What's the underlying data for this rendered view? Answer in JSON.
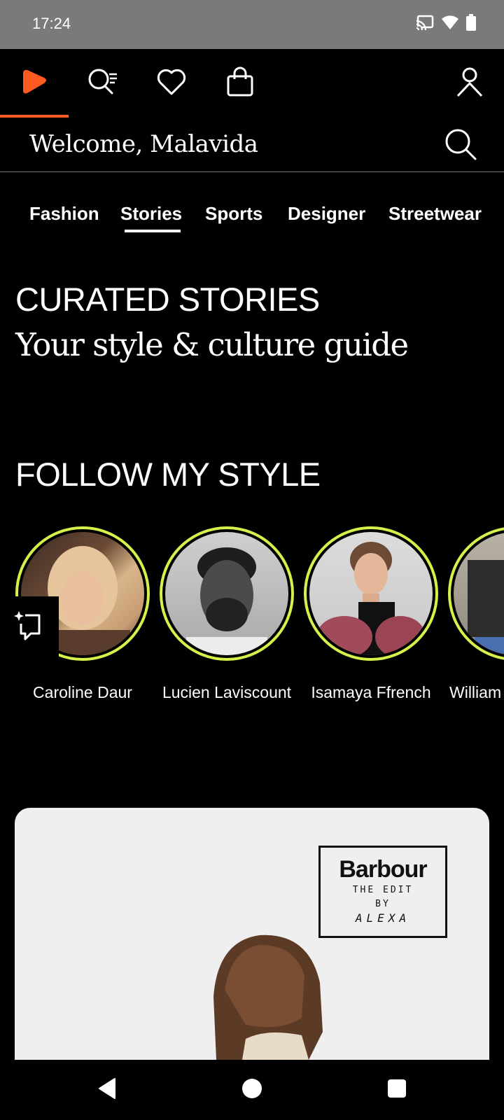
{
  "status_bar": {
    "time": "17:24",
    "icons": [
      "cast-icon",
      "wifi-icon",
      "battery-icon"
    ]
  },
  "top_nav": {
    "items": [
      "home-icon",
      "search-list-icon",
      "heart-icon",
      "bag-icon",
      "profile-icon"
    ],
    "active": "home-icon",
    "accent_color": "#ff5a1f"
  },
  "header": {
    "welcome": "Welcome, Malavida"
  },
  "tabs": {
    "items": [
      "Fashion",
      "Stories",
      "Sports",
      "Designer",
      "Streetwear"
    ],
    "selected": "Stories"
  },
  "curated": {
    "title": "CURATED STORIES",
    "subtitle": "Your style & culture guide"
  },
  "follow": {
    "title": "FOLLOW MY STYLE",
    "ring_color": "#d7f04a",
    "creators": [
      {
        "name": "Caroline Daur"
      },
      {
        "name": "Lucien Laviscount"
      },
      {
        "name": "Isamaya Ffrench"
      },
      {
        "name": "William"
      }
    ]
  },
  "card": {
    "brand": "Barbour",
    "line1": "THE EDIT",
    "line2": "BY",
    "line3": "ALEXA"
  }
}
